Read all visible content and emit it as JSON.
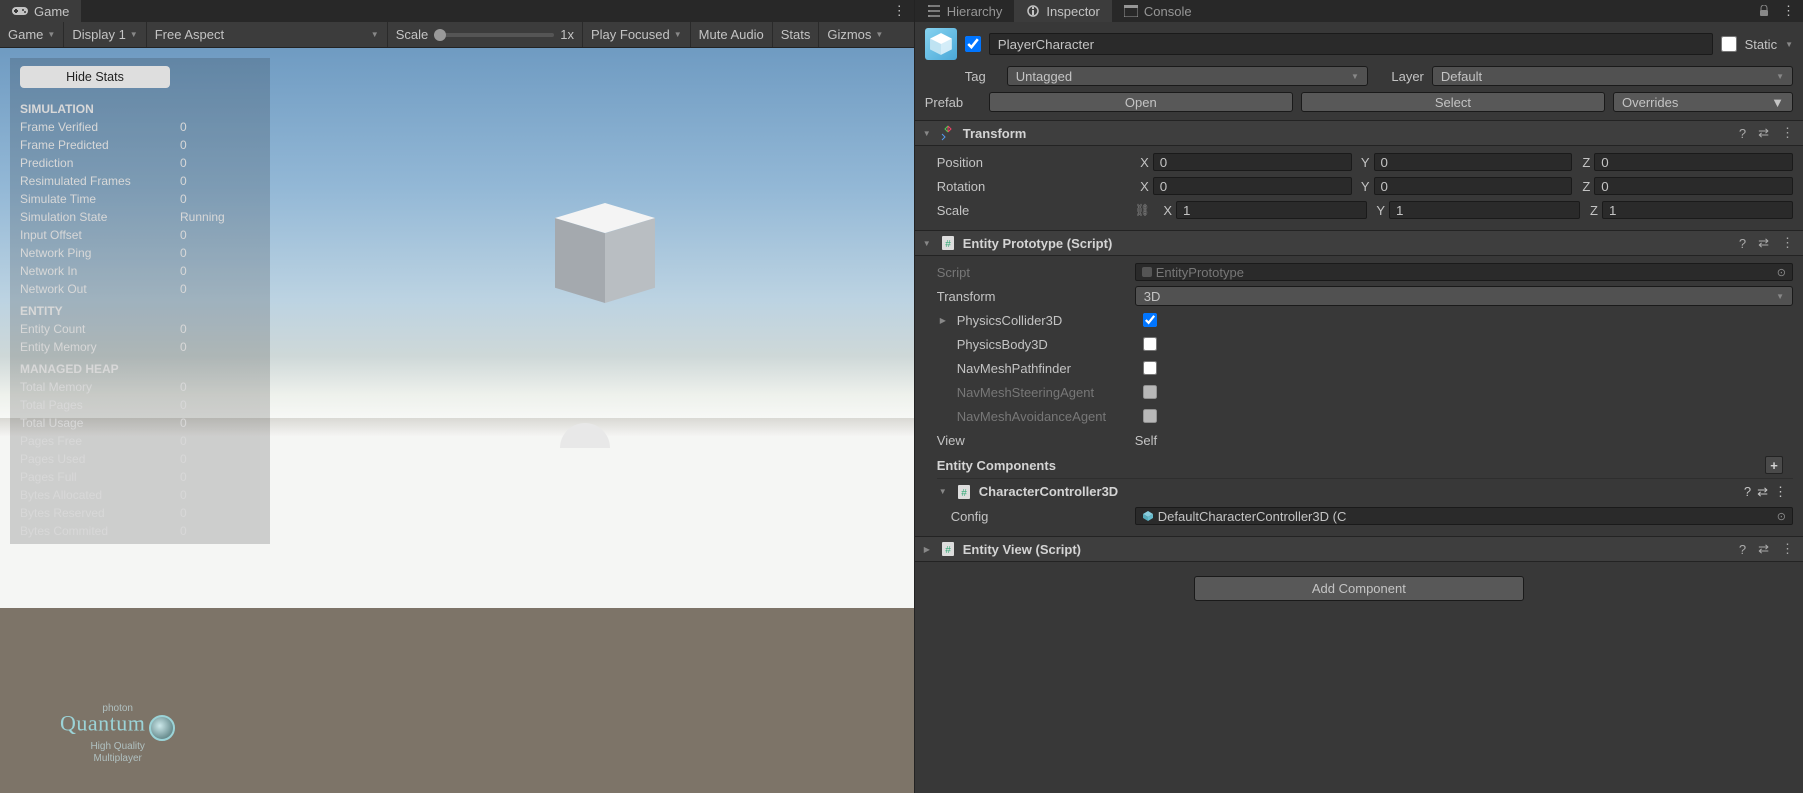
{
  "game": {
    "tab_label": "Game",
    "dd_view": "Game",
    "dd_display": "Display 1",
    "dd_aspect": "Free Aspect",
    "scale_label": "Scale",
    "scale_value": "1x",
    "dd_play": "Play Focused",
    "mute": "Mute Audio",
    "stats": "Stats",
    "gizmos": "Gizmos"
  },
  "stats": {
    "hide_btn": "Hide Stats",
    "groups": [
      {
        "title": "SIMULATION",
        "rows": [
          {
            "k": "Frame Verified",
            "v": "0"
          },
          {
            "k": "Frame Predicted",
            "v": "0"
          },
          {
            "k": "Prediction",
            "v": "0"
          },
          {
            "k": "Resimulated Frames",
            "v": "0"
          },
          {
            "k": "Simulate Time",
            "v": "0"
          },
          {
            "k": "Simulation State",
            "v": "Running"
          },
          {
            "k": "Input Offset",
            "v": "0"
          },
          {
            "k": "Network Ping",
            "v": "0"
          },
          {
            "k": "Network In",
            "v": "0"
          },
          {
            "k": "Network Out",
            "v": "0"
          }
        ]
      },
      {
        "title": "ENTITY",
        "rows": [
          {
            "k": "Entity Count",
            "v": "0"
          },
          {
            "k": "Entity Memory",
            "v": "0"
          }
        ]
      },
      {
        "title": "MANAGED HEAP",
        "rows": [
          {
            "k": "Total Memory",
            "v": "0"
          },
          {
            "k": "Total Pages",
            "v": "0"
          },
          {
            "k": "Total Usage",
            "v": "0"
          },
          {
            "k": "Pages Free",
            "v": "0"
          },
          {
            "k": "Pages Used",
            "v": "0"
          },
          {
            "k": "Pages Full",
            "v": "0"
          },
          {
            "k": "Bytes Allocated",
            "v": "0"
          },
          {
            "k": "Bytes Reserved",
            "v": "0"
          },
          {
            "k": "Bytes Commited",
            "v": "0"
          }
        ]
      }
    ]
  },
  "photon": {
    "top": "photon",
    "brand": "Quantum",
    "sub1": "High Quality",
    "sub2": "Multiplayer"
  },
  "tabs": {
    "hierarchy": "Hierarchy",
    "inspector": "Inspector",
    "console": "Console"
  },
  "inspector": {
    "name": "PlayerCharacter",
    "static_label": "Static",
    "tag_label": "Tag",
    "tag_value": "Untagged",
    "layer_label": "Layer",
    "layer_value": "Default",
    "prefab_label": "Prefab",
    "open": "Open",
    "select": "Select",
    "overrides": "Overrides",
    "transform": {
      "title": "Transform",
      "position": "Position",
      "rotation": "Rotation",
      "scale": "Scale",
      "pos": {
        "x": "0",
        "y": "0",
        "z": "0"
      },
      "rot": {
        "x": "0",
        "y": "0",
        "z": "0"
      },
      "scl": {
        "x": "1",
        "y": "1",
        "z": "1"
      }
    },
    "entityProto": {
      "title": "Entity Prototype (Script)",
      "script_label": "Script",
      "script_value": "EntityPrototype",
      "transform_label": "Transform",
      "transform_value": "3D",
      "physicsCollider": "PhysicsCollider3D",
      "physicsCollider_checked": true,
      "physicsBody": "PhysicsBody3D",
      "navPath": "NavMeshPathfinder",
      "navSteer": "NavMeshSteeringAgent",
      "navAvoid": "NavMeshAvoidanceAgent",
      "view_label": "View",
      "view_value": "Self",
      "entComps": "Entity Components",
      "cc3d_title": "CharacterController3D",
      "cc3d_config_label": "Config",
      "cc3d_config_value": "DefaultCharacterController3D (C"
    },
    "entityView": {
      "title": "Entity View (Script)"
    },
    "add_component": "Add Component"
  }
}
